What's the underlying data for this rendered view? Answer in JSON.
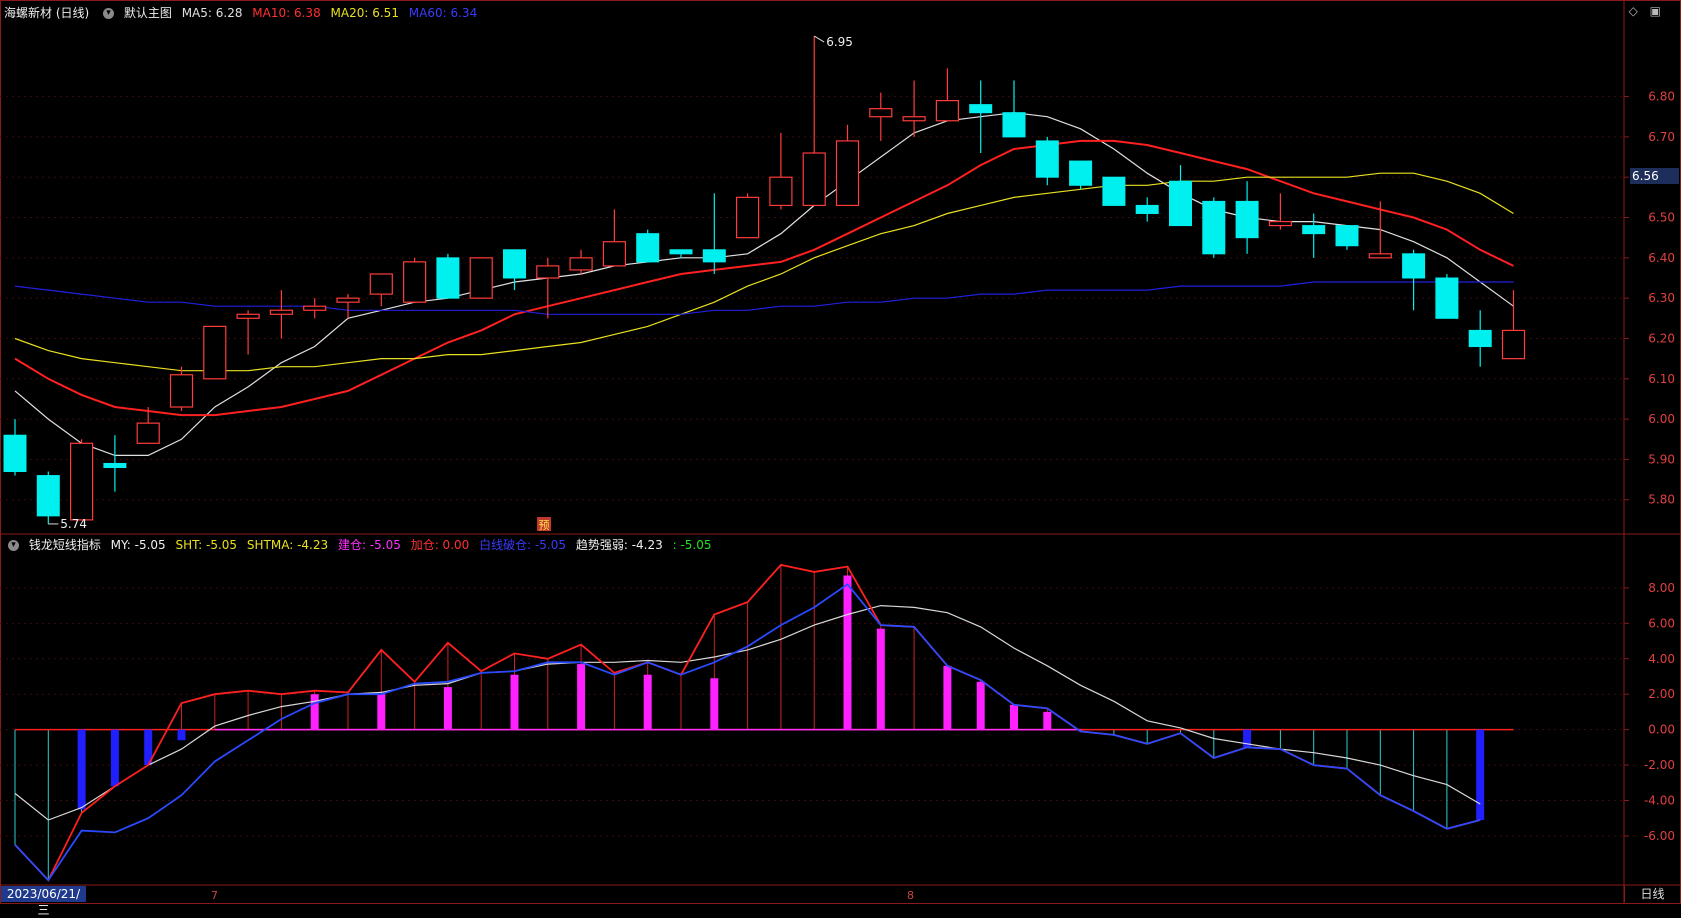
{
  "header": {
    "stock": "海螺新材 (日线)",
    "chart_name": "默认主图",
    "ma5": "MA5: 6.28",
    "ma10": "MA10: 6.38",
    "ma20": "MA20: 6.51",
    "ma60": "MA60: 6.34"
  },
  "indicator_header": {
    "name": "钱龙短线指标",
    "my": "MY: -5.05",
    "sht": "SHT: -5.05",
    "shtma": "SHTMA: -4.23",
    "jiancang": "建仓: -5.05",
    "jiacang": "加仓: 0.00",
    "baixian": "白线破仓: -5.05",
    "qushi": "趋势强弱: -4.23",
    "last": ": -5.05"
  },
  "icons": {
    "diamond": "◇",
    "panel": "▣"
  },
  "price_axis": [
    "6.80",
    "6.70",
    "6.60",
    "6.50",
    "6.40",
    "6.30",
    "6.20",
    "6.10",
    "6.00",
    "5.90",
    "5.80"
  ],
  "indicator_axis": [
    "8.00",
    "6.00",
    "4.00",
    "2.00",
    "0.00",
    "-2.00",
    "-4.00",
    "-6.00"
  ],
  "current_price": "6.56",
  "high_label": "6.95",
  "low_label": "5.74",
  "marker": "预",
  "bottom_date": "2023/06/21/三",
  "month_labels": [
    "7",
    "8"
  ],
  "period": "日线",
  "colors": {
    "up": "#ff3b3b",
    "down": "#00f0f0",
    "ma5": "#e0e0e0",
    "ma10": "#ff2020",
    "ma20": "#e8e020",
    "ma60": "#2020e0",
    "grid": "#8b1a1a"
  },
  "chart_data": [
    {
      "type": "candlestick",
      "y_range": [
        5.72,
        6.98
      ],
      "candles": [
        [
          5.96,
          5.87,
          6.0,
          5.86
        ],
        [
          5.86,
          5.76,
          5.87,
          5.74
        ],
        [
          5.75,
          5.94,
          5.95,
          5.75
        ],
        [
          5.89,
          5.88,
          5.96,
          5.82
        ],
        [
          5.94,
          5.99,
          6.03,
          5.94
        ],
        [
          6.03,
          6.11,
          6.13,
          6.02
        ],
        [
          6.1,
          6.23,
          6.23,
          6.1
        ],
        [
          6.25,
          6.26,
          6.27,
          6.16
        ],
        [
          6.26,
          6.27,
          6.32,
          6.2
        ],
        [
          6.27,
          6.28,
          6.3,
          6.25
        ],
        [
          6.29,
          6.3,
          6.31,
          6.25
        ],
        [
          6.31,
          6.36,
          6.36,
          6.28
        ],
        [
          6.29,
          6.39,
          6.4,
          6.29
        ],
        [
          6.4,
          6.3,
          6.41,
          6.3
        ],
        [
          6.3,
          6.4,
          6.4,
          6.3
        ],
        [
          6.42,
          6.35,
          6.42,
          6.32
        ],
        [
          6.35,
          6.38,
          6.4,
          6.25
        ],
        [
          6.37,
          6.4,
          6.42,
          6.36
        ],
        [
          6.38,
          6.44,
          6.52,
          6.38
        ],
        [
          6.46,
          6.39,
          6.47,
          6.39
        ],
        [
          6.42,
          6.41,
          6.42,
          6.4
        ],
        [
          6.42,
          6.39,
          6.56,
          6.36
        ],
        [
          6.45,
          6.55,
          6.56,
          6.45
        ],
        [
          6.53,
          6.6,
          6.71,
          6.52
        ],
        [
          6.53,
          6.66,
          6.95,
          6.53
        ],
        [
          6.53,
          6.69,
          6.73,
          6.53
        ],
        [
          6.75,
          6.77,
          6.81,
          6.69
        ],
        [
          6.74,
          6.75,
          6.84,
          6.7
        ],
        [
          6.74,
          6.79,
          6.87,
          6.74
        ],
        [
          6.78,
          6.76,
          6.84,
          6.66
        ],
        [
          6.76,
          6.7,
          6.84,
          6.7
        ],
        [
          6.69,
          6.6,
          6.7,
          6.58
        ],
        [
          6.64,
          6.58,
          6.64,
          6.57
        ],
        [
          6.6,
          6.53,
          6.6,
          6.53
        ],
        [
          6.53,
          6.51,
          6.55,
          6.49
        ],
        [
          6.59,
          6.48,
          6.63,
          6.48
        ],
        [
          6.54,
          6.41,
          6.55,
          6.4
        ],
        [
          6.54,
          6.45,
          6.59,
          6.41
        ],
        [
          6.48,
          6.49,
          6.56,
          6.47
        ],
        [
          6.48,
          6.46,
          6.51,
          6.4
        ],
        [
          6.48,
          6.43,
          6.48,
          6.42
        ],
        [
          6.4,
          6.41,
          6.54,
          6.4
        ],
        [
          6.41,
          6.35,
          6.42,
          6.27
        ],
        [
          6.35,
          6.25,
          6.36,
          6.25
        ],
        [
          6.22,
          6.18,
          6.27,
          6.13
        ],
        [
          6.15,
          6.22,
          6.32,
          6.15
        ]
      ],
      "series": [
        {
          "name": "MA5",
          "values": [
            6.07,
            6.0,
            5.94,
            5.91,
            5.91,
            5.95,
            6.03,
            6.08,
            6.14,
            6.18,
            6.25,
            6.27,
            6.29,
            6.3,
            6.32,
            6.34,
            6.35,
            6.36,
            6.38,
            6.39,
            6.4,
            6.4,
            6.41,
            6.46,
            6.53,
            6.59,
            6.65,
            6.71,
            6.74,
            6.75,
            6.76,
            6.75,
            6.72,
            6.67,
            6.61,
            6.56,
            6.52,
            6.5,
            6.49,
            6.49,
            6.48,
            6.47,
            6.44,
            6.4,
            6.34,
            6.28
          ]
        },
        {
          "name": "MA10",
          "values": [
            6.15,
            6.1,
            6.06,
            6.03,
            6.02,
            6.01,
            6.01,
            6.02,
            6.03,
            6.05,
            6.07,
            6.11,
            6.15,
            6.19,
            6.22,
            6.26,
            6.28,
            6.3,
            6.32,
            6.34,
            6.36,
            6.37,
            6.38,
            6.39,
            6.42,
            6.46,
            6.5,
            6.54,
            6.58,
            6.63,
            6.67,
            6.68,
            6.69,
            6.69,
            6.68,
            6.66,
            6.64,
            6.62,
            6.59,
            6.56,
            6.54,
            6.52,
            6.5,
            6.47,
            6.42,
            6.38
          ]
        },
        {
          "name": "MA20",
          "values": [
            6.2,
            6.17,
            6.15,
            6.14,
            6.13,
            6.12,
            6.12,
            6.12,
            6.13,
            6.13,
            6.14,
            6.15,
            6.15,
            6.16,
            6.16,
            6.17,
            6.18,
            6.19,
            6.21,
            6.23,
            6.26,
            6.29,
            6.33,
            6.36,
            6.4,
            6.43,
            6.46,
            6.48,
            6.51,
            6.53,
            6.55,
            6.56,
            6.57,
            6.58,
            6.58,
            6.59,
            6.59,
            6.6,
            6.6,
            6.6,
            6.6,
            6.61,
            6.61,
            6.59,
            6.56,
            6.51
          ]
        },
        {
          "name": "MA60",
          "values": [
            6.33,
            6.32,
            6.31,
            6.3,
            6.29,
            6.29,
            6.28,
            6.28,
            6.28,
            6.28,
            6.27,
            6.27,
            6.27,
            6.27,
            6.27,
            6.27,
            6.26,
            6.26,
            6.26,
            6.26,
            6.26,
            6.27,
            6.27,
            6.28,
            6.28,
            6.29,
            6.29,
            6.3,
            6.3,
            6.31,
            6.31,
            6.32,
            6.32,
            6.32,
            6.32,
            6.33,
            6.33,
            6.33,
            6.33,
            6.34,
            6.34,
            6.34,
            6.34,
            6.34,
            6.34,
            6.34
          ]
        }
      ]
    },
    {
      "type": "indicator",
      "y_range": [
        -8.6,
        9.8
      ],
      "red_line": [
        -6.5,
        -8.5,
        -4.7,
        -3.2,
        -2.0,
        1.5,
        2.0,
        2.2,
        2.0,
        2.2,
        2.1,
        4.5,
        2.7,
        4.9,
        3.3,
        4.3,
        4.0,
        4.8,
        3.2,
        3.8,
        3.1,
        6.5,
        7.2,
        9.3,
        8.9,
        9.2,
        5.9,
        5.8,
        3.6,
        2.8,
        1.4,
        1.2,
        -0.1,
        -0.3,
        -0.8,
        -0.2,
        -1.6,
        -1.0,
        -1.1,
        -2.0,
        -2.2,
        -3.7,
        -4.6,
        -5.6,
        -5.1
      ],
      "blue_line": [
        -6.5,
        -8.5,
        -5.7,
        -5.8,
        -5.0,
        -3.7,
        -1.8,
        -0.6,
        0.6,
        1.5,
        2.0,
        2.0,
        2.6,
        2.7,
        3.2,
        3.3,
        3.8,
        3.8,
        3.1,
        3.8,
        3.1,
        3.8,
        4.7,
        5.9,
        6.9,
        8.2,
        5.9,
        5.8,
        3.6,
        2.8,
        1.4,
        1.2,
        -0.1,
        -0.3,
        -0.8,
        -0.2,
        -1.6,
        -1.0,
        -1.1,
        -2.0,
        -2.2,
        -3.7,
        -4.6,
        -5.6,
        -5.1
      ],
      "white_line": [
        -3.6,
        -5.1,
        -4.4,
        -3.2,
        -2.0,
        -1.1,
        0.2,
        0.8,
        1.3,
        1.6,
        2.0,
        2.1,
        2.5,
        2.6,
        3.2,
        3.3,
        3.7,
        3.8,
        3.8,
        3.9,
        3.8,
        4.1,
        4.5,
        5.1,
        5.9,
        6.5,
        7.0,
        6.9,
        6.6,
        5.8,
        4.6,
        3.6,
        2.5,
        1.6,
        0.5,
        0.1,
        -0.5,
        -0.8,
        -1.1,
        -1.3,
        -1.6,
        -2.0,
        -2.6,
        -3.1,
        -4.2
      ],
      "bars": [
        0,
        0,
        -4.5,
        -3.2,
        -2.0,
        -0.6,
        0,
        0,
        0,
        2.0,
        0,
        2.0,
        0,
        2.4,
        0,
        3.1,
        0,
        3.7,
        0,
        3.1,
        0,
        2.9,
        0,
        0,
        0,
        8.7,
        5.7,
        0,
        3.6,
        2.7,
        1.4,
        1.0,
        0,
        0,
        0,
        0,
        0,
        -1.0,
        0,
        0,
        0,
        0,
        0,
        0,
        -5.1
      ]
    }
  ]
}
